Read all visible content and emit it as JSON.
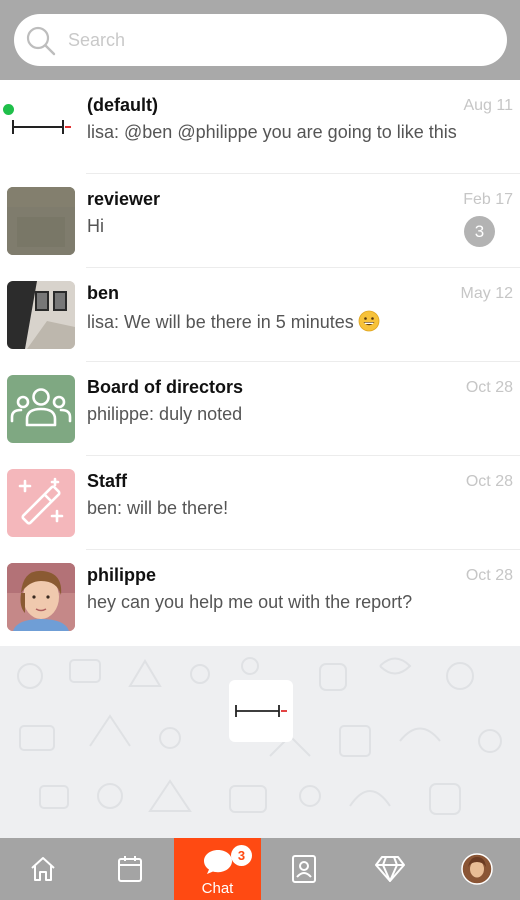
{
  "search": {
    "placeholder": "Search"
  },
  "chats": [
    {
      "name": "(default)",
      "preview": "lisa: @ben @philippe you are going to like this",
      "date": "Aug 11",
      "avatar": "app-logo-icon"
    },
    {
      "name": "reviewer",
      "preview": "Hi",
      "date": "Feb 17",
      "unread": "3",
      "online": true,
      "avatar": "photo"
    },
    {
      "name": "ben",
      "preview": "lisa: We will be there in 5 minutes",
      "date": "May 12",
      "emoji": "grinning-face-icon",
      "avatar": "photo"
    },
    {
      "name": "Board of directors",
      "preview": "philippe: duly noted",
      "date": "Oct 28",
      "avatar": "group-icon"
    },
    {
      "name": "Staff",
      "preview": "ben: will be there!",
      "date": "Oct 28",
      "avatar": "magic-wand-icon"
    },
    {
      "name": "philippe",
      "preview": "hey can you help me out with the report?",
      "date": "Oct 28",
      "avatar": "photo"
    }
  ],
  "nav": {
    "items": [
      "home-icon",
      "calendar-icon",
      "chat-icon",
      "contacts-icon",
      "diamond-icon",
      "profile-avatar"
    ],
    "chat_label": "Chat",
    "chat_badge": "3",
    "active": "chat"
  },
  "colors": {
    "accent": "#ff4a12",
    "header": "#a9a9a9",
    "online": "#1fbf4a",
    "group_avatar": "#7fa882",
    "staff_avatar": "#f4b7bb"
  }
}
